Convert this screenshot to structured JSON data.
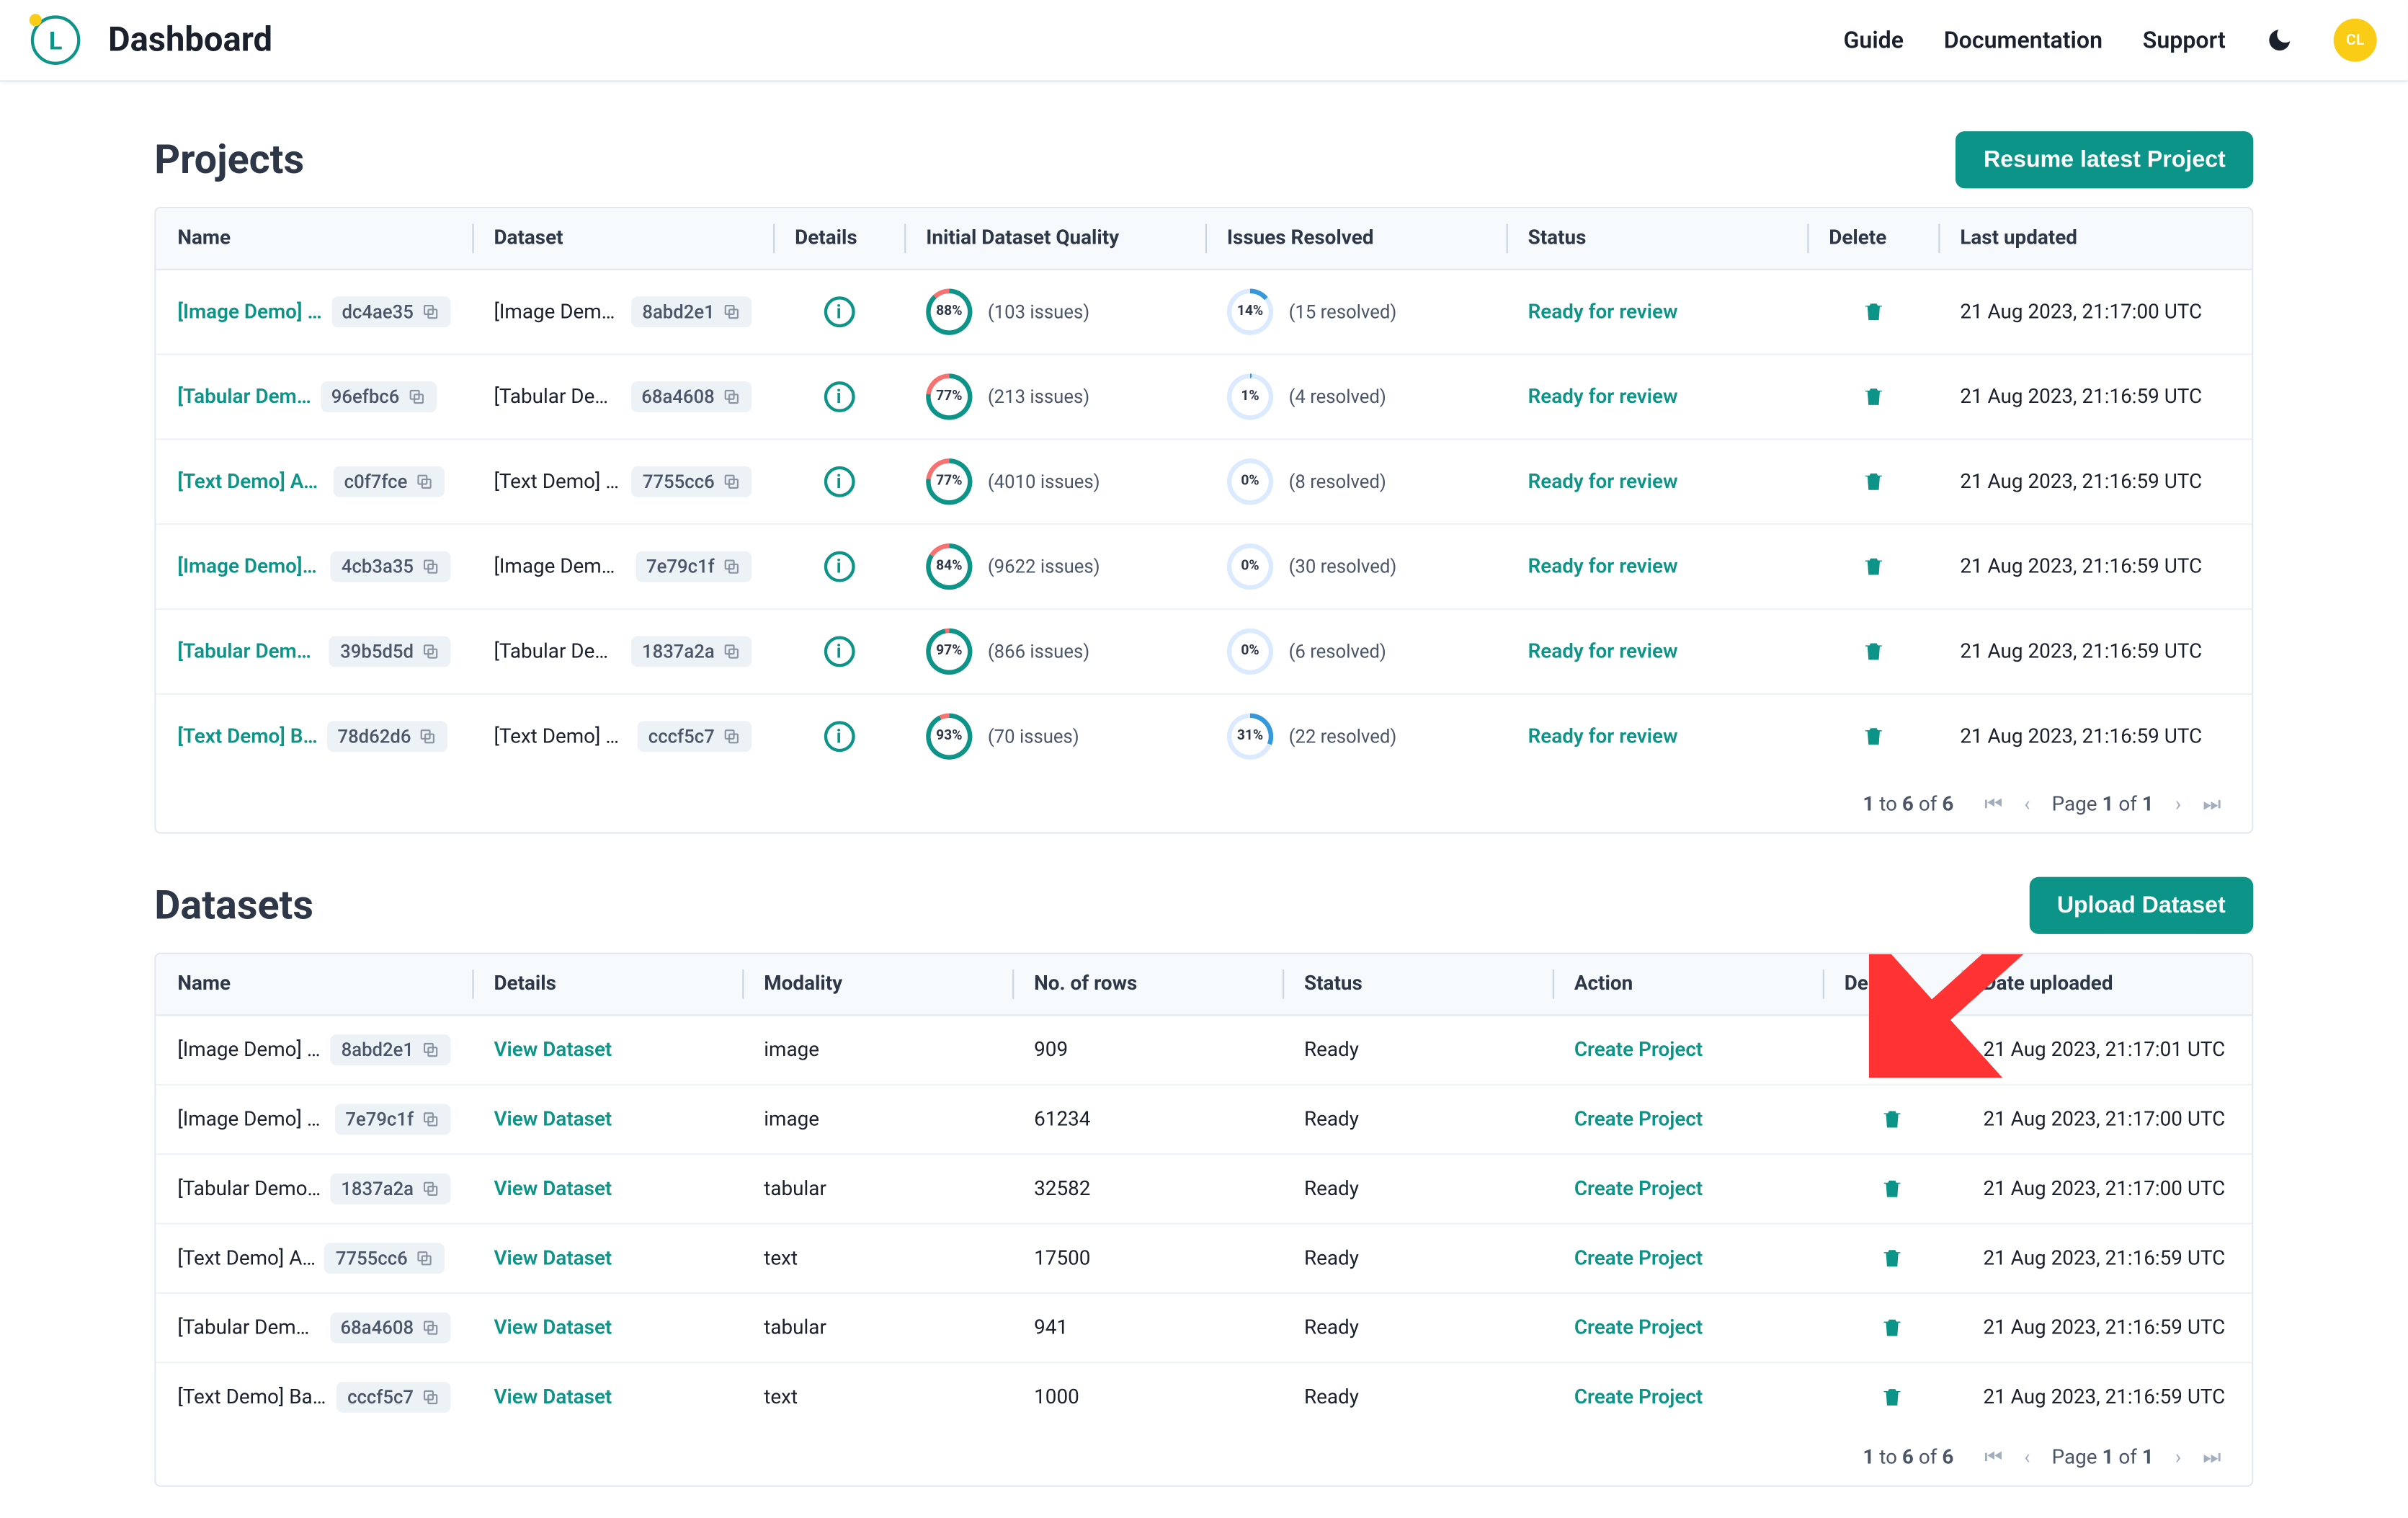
{
  "header": {
    "title": "Dashboard",
    "nav": [
      "Guide",
      "Documentation",
      "Support"
    ],
    "avatar": "CL"
  },
  "projects": {
    "title": "Projects",
    "button": "Resume latest Project",
    "cols": [
      "Name",
      "Dataset",
      "Details",
      "Initial Dataset Quality",
      "Issues Resolved",
      "Status",
      "Delete",
      "Last updated"
    ],
    "rows": [
      {
        "name": "[Image Demo] …",
        "name_id": "dc4ae35",
        "dset": "[Image Demo]…",
        "dset_id": "8abd2e1",
        "quality": 88,
        "quality_txt": "(103 issues)",
        "resolved": 14,
        "resolved_txt": "(15 resolved)",
        "status": "Ready for review",
        "updated": "21 Aug 2023, 21:17:00 UTC"
      },
      {
        "name": "[Tabular Dem…",
        "name_id": "96efbc6",
        "dset": "[Tabular Dem…",
        "dset_id": "68a4608",
        "quality": 77,
        "quality_txt": "(213 issues)",
        "resolved": 1,
        "resolved_txt": "(4 resolved)",
        "status": "Ready for review",
        "updated": "21 Aug 2023, 21:16:59 UTC"
      },
      {
        "name": "[Text Demo] Am…",
        "name_id": "c0f7fce",
        "dset": "[Text Demo] A…",
        "dset_id": "7755cc6",
        "quality": 77,
        "quality_txt": "(4010 issues)",
        "resolved": 0,
        "resolved_txt": "(8 resolved)",
        "status": "Ready for review",
        "updated": "21 Aug 2023, 21:16:59 UTC"
      },
      {
        "name": "[Image Demo] …",
        "name_id": "4cb3a35",
        "dset": "[Image Demo] …",
        "dset_id": "7e79c1f",
        "quality": 84,
        "quality_txt": "(9622 issues)",
        "resolved": 0,
        "resolved_txt": "(30 resolved)",
        "status": "Ready for review",
        "updated": "21 Aug 2023, 21:16:59 UTC"
      },
      {
        "name": "[Tabular Demo…",
        "name_id": "39b5d5d",
        "dset": "[Tabular Demo…",
        "dset_id": "1837a2a",
        "quality": 97,
        "quality_txt": "(866 issues)",
        "resolved": 0,
        "resolved_txt": "(6 resolved)",
        "status": "Ready for review",
        "updated": "21 Aug 2023, 21:16:59 UTC"
      },
      {
        "name": "[Text Demo] B…",
        "name_id": "78d62d6",
        "dset": "[Text Demo] B…",
        "dset_id": "cccf5c7",
        "quality": 93,
        "quality_txt": "(70 issues)",
        "resolved": 31,
        "resolved_txt": "(22 resolved)",
        "status": "Ready for review",
        "updated": "21 Aug 2023, 21:16:59 UTC"
      }
    ],
    "footer": {
      "range": "1",
      "to": "to",
      "end": "6",
      "of": "of",
      "total": "6",
      "page_label": "Page",
      "page": "1",
      "page_of": "of",
      "page_total": "1"
    }
  },
  "datasets": {
    "title": "Datasets",
    "button": "Upload Dataset",
    "cols": [
      "Name",
      "Details",
      "Modality",
      "No. of rows",
      "Status",
      "Action",
      "Delete",
      "Date uploaded"
    ],
    "rows": [
      {
        "name": "[Image Demo] F…",
        "id": "8abd2e1",
        "detail": "View Dataset",
        "modality": "image",
        "rows": "909",
        "status": "Ready",
        "action": "Create Project",
        "date": "21 Aug 2023, 21:17:01 UTC"
      },
      {
        "name": "[Image Demo] W…",
        "id": "7e79c1f",
        "detail": "View Dataset",
        "modality": "image",
        "rows": "61234",
        "status": "Ready",
        "action": "Create Project",
        "date": "21 Aug 2023, 21:17:00 UTC"
      },
      {
        "name": "[Tabular Demo] …",
        "id": "1837a2a",
        "detail": "View Dataset",
        "modality": "tabular",
        "rows": "32582",
        "status": "Ready",
        "action": "Create Project",
        "date": "21 Aug 2023, 21:17:00 UTC"
      },
      {
        "name": "[Text Demo] A…",
        "id": "7755cc6",
        "detail": "View Dataset",
        "modality": "text",
        "rows": "17500",
        "status": "Ready",
        "action": "Create Project",
        "date": "21 Aug 2023, 21:16:59 UTC"
      },
      {
        "name": "[Tabular Demo]…",
        "id": "68a4608",
        "detail": "View Dataset",
        "modality": "tabular",
        "rows": "941",
        "status": "Ready",
        "action": "Create Project",
        "date": "21 Aug 2023, 21:16:59 UTC"
      },
      {
        "name": "[Text Demo] Ban…",
        "id": "cccf5c7",
        "detail": "View Dataset",
        "modality": "text",
        "rows": "1000",
        "status": "Ready",
        "action": "Create Project",
        "date": "21 Aug 2023, 21:16:59 UTC"
      }
    ],
    "footer": {
      "range": "1",
      "to": "to",
      "end": "6",
      "of": "of",
      "total": "6",
      "page_label": "Page",
      "page": "1",
      "page_of": "of",
      "page_total": "1"
    }
  }
}
